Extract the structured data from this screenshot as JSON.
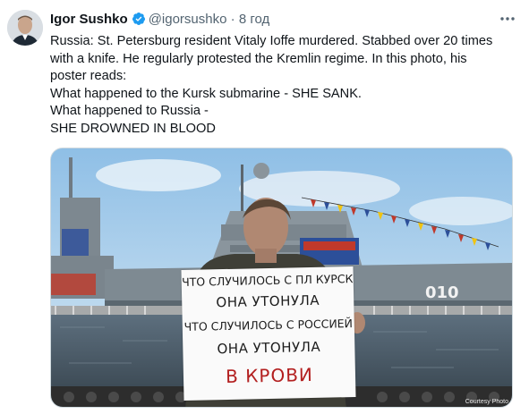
{
  "tweet": {
    "author_name": "Igor Sushko",
    "handle": "@igorsushko",
    "separator": "·",
    "time": "8 год",
    "lines": [
      "Russia: St. Petersburg resident Vitaly Ioffe murdered. Stabbed over 20 times",
      "with a knife. He regularly protested the Kremlin regime. In this photo, his",
      "poster reads:",
      "What happened to the Kursk submarine - SHE SANK.",
      "What happened to Russia -",
      "SHE DROWNED IN BLOOD"
    ]
  },
  "photo": {
    "sign_lines": [
      "ЧТО СЛУЧИЛОСЬ С ПЛ КУРСК",
      "ОНА УТОНУЛА",
      "ЧТО СЛУЧИЛОСЬ С РОССИЕЙ",
      "ОНА УТОНУЛА",
      "В КРОВИ"
    ],
    "hull_number": "010",
    "credit": "Courtesy Photo"
  },
  "icons": {
    "verified": "verified-badge-icon",
    "more": "more-options-icon"
  },
  "colors": {
    "verified": "#1d9bf0",
    "secondary_text": "#536471",
    "sign_red": "#b32020"
  }
}
